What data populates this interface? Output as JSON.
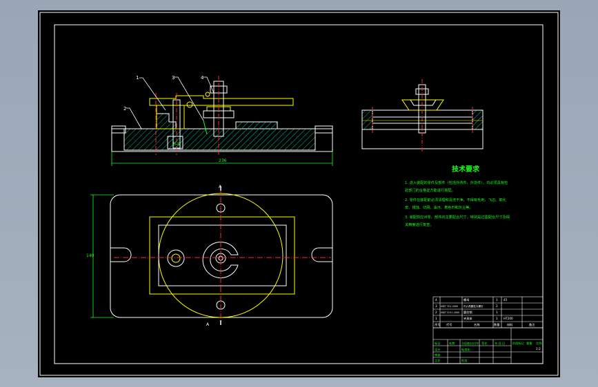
{
  "viewport": {
    "background": "#9aa6b6",
    "sheet_color": "#000000"
  },
  "colors": {
    "outline": "#ffffff",
    "hatch": "#00c8a0",
    "cyan": "#00e5ff",
    "yellow": "#ffff00",
    "centerline": "#ff2a2a",
    "green": "#19ff19",
    "magenta": "#ff33ff"
  },
  "front_view": {
    "callouts": [
      "1",
      "2",
      "3",
      "4"
    ],
    "width_dimension": "236",
    "section_label": "B-B"
  },
  "top_view": {
    "height_dimension": "140",
    "section_marks": [
      "A",
      "A"
    ]
  },
  "technical_requirements": {
    "title": "技术要求",
    "items": [
      "1. 进入装配的零件及部件（包括外购件、外协件），均必须具有检",
      "验部门的合格证方能进行装配。",
      "2. 零件在装配前必须清理和清洗干净，不得有毛刺、飞边、氧化",
      "皮、锈蚀、切屑、油污、着色剂和灰尘等。",
      "3. 装配前应对零、部件的主要配合尺寸，特别是过盈配合尺寸及相",
      "关精度进行复查。"
    ]
  },
  "title_block": {
    "parts_list": {
      "rows": [
        {
          "no": "4",
          "code": "",
          "name": "螺母",
          "qty": "1",
          "material": "45",
          "note": ""
        },
        {
          "no": "3",
          "code": "GB/T 70.1-2000",
          "name": "内六角圆柱头螺钉",
          "qty": "2",
          "material": "",
          "note": ""
        },
        {
          "no": "2",
          "code": "GB/T 119.1-2000",
          "name": "圆柱销",
          "qty": "1",
          "material": "",
          "note": ""
        },
        {
          "no": "1",
          "code": "",
          "name": "夹具体",
          "qty": "1",
          "material": "HT200",
          "note": ""
        }
      ],
      "header": {
        "no": "序号",
        "code": "代号",
        "name": "名称",
        "qty": "数量",
        "material": "材料",
        "note": "备注"
      }
    },
    "signature_labels": [
      "标记",
      "处数",
      "分区",
      "更改文件号",
      "签名",
      "年.月.日"
    ],
    "design_labels": [
      "设计",
      "审核",
      "工艺",
      "标准化",
      "批准"
    ],
    "stage_labels": [
      "阶段标记",
      "重量",
      "比例"
    ],
    "scale": "1:2"
  }
}
